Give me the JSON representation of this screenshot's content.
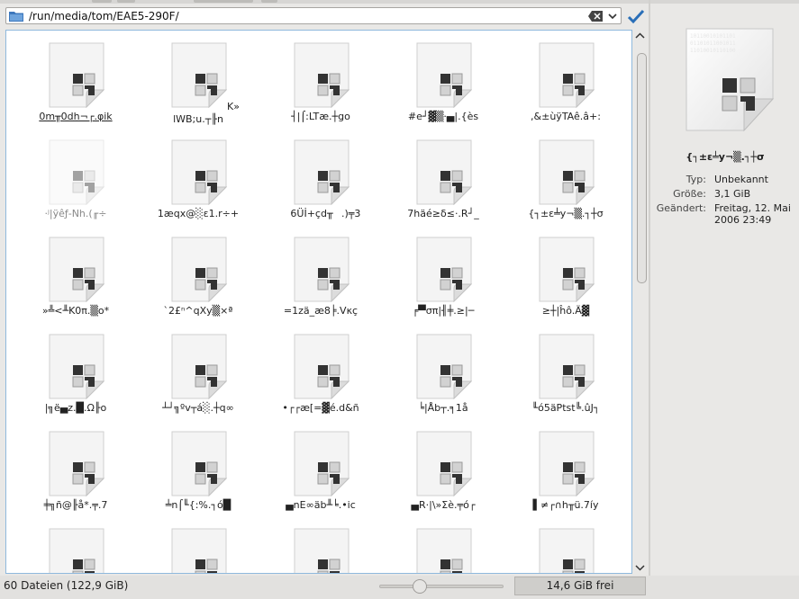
{
  "location": {
    "path": "/run/media/tom/EAE5-290F/"
  },
  "files": [
    {
      "name": "0m╥0dh¬┌.φik",
      "state": "underlined"
    },
    {
      "name": "lWB;u.┬╟n",
      "extra": "K»",
      "state": "twoline"
    },
    {
      "name": "┤|⌠:LTæ.┼go",
      "state": "normal"
    },
    {
      "name": "#e┘▓▒·▄|.{ès",
      "state": "normal"
    },
    {
      "name": ",&±ùÿTAê.â+:",
      "state": "normal"
    },
    {
      "name": "·ʲ|ÿêƒ-Nh.(╓÷",
      "state": "dim"
    },
    {
      "name": "1æqx@░ε1.r÷+",
      "state": "normal"
    },
    {
      "name": "6Üİ+çd╥",
      "extra": ".)╤3",
      "state": "normal"
    },
    {
      "name": "7häé≥δ≤·.R┘_",
      "state": "normal"
    },
    {
      "name": "{┐±ε╧y¬▒.┐┼σ",
      "state": "normal"
    },
    {
      "name": "»╩<╨K0π.▒o*",
      "state": "normal"
    },
    {
      "name": "`2£ⁿ^qXy▒×ª",
      "state": "normal"
    },
    {
      "name": "=1zä_æ8╞.Vκç",
      "state": "normal"
    },
    {
      "name": "╒▀σπ|╢╪.≥|─",
      "state": "normal"
    },
    {
      "name": "≥┼|ĥô.Ä▓",
      "state": "normal"
    },
    {
      "name": "|╗ë▄z.█.Ω╟o",
      "state": "normal"
    },
    {
      "name": "┴┘╗ºv┬á░.┼q∞",
      "state": "normal"
    },
    {
      "name": "•┌┌æ[=▓é.d&ñ",
      "state": "normal"
    },
    {
      "name": "╘|Åb┬.╕1å",
      "state": "normal"
    },
    {
      "name": "╙ó5äPtst╚.ûJ┐",
      "state": "normal"
    },
    {
      "name": "╪╗ñ@╟å*.╤.7",
      "state": "normal"
    },
    {
      "name": "╧n⌠╙{:%.┐ó█",
      "state": "normal"
    },
    {
      "name": "▄nE∞äb╨╘.•ic",
      "state": "normal"
    },
    {
      "name": "▄R·|\\»Σè.╤ó┌",
      "state": "normal"
    },
    {
      "name": "▌≠┌∩h╥ü.7íy",
      "state": "normal"
    }
  ],
  "sidebar": {
    "file_name": "{┐±ε╧y¬▒.┐┼σ",
    "labels": {
      "type": "Typ:",
      "size": "Größe:",
      "modified": "Geändert:"
    },
    "values": {
      "type": "Unbekannt",
      "size": "3,1 GiB",
      "modified": "Freitag, 12. Mai 2006 23:49"
    }
  },
  "status": {
    "count": "60 Dateien (122,9 GiB)",
    "free": "14,6 GiB frei",
    "zoom_level": 0.3
  },
  "colors": {
    "selection_border": "#8fb9dd",
    "accent_blue": "#2a6fb8"
  }
}
